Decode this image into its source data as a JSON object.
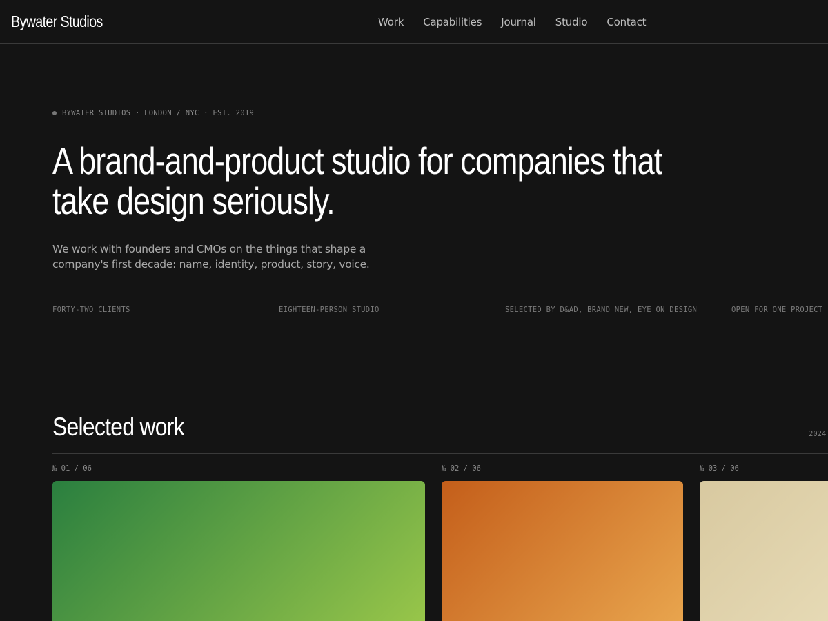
{
  "header": {
    "brand": "Bywater Studios",
    "nav": [
      "Work",
      "Capabilities",
      "Journal",
      "Studio",
      "Contact"
    ]
  },
  "hero": {
    "eyebrow": "BYWATER STUDIOS · LONDON / NYC · EST. 2019",
    "headline": "A brand-and-product studio for companies that take design seriously.",
    "lede": "We work with founders and CMOs on the things that shape a company's first decade: name, identity, product, story, voice.",
    "stats": [
      "FORTY-TWO CLIENTS",
      "EIGHTEEN-PERSON STUDIO",
      "SELECTED BY D&AD, BRAND NEW, EYE ON DESIGN",
      "OPEN FOR ONE PROJECT ·"
    ]
  },
  "work": {
    "title": "Selected work",
    "year": "2024",
    "items": [
      {
        "number": "№ 01 / 06",
        "gradient_from": "#2a7f3f",
        "gradient_to": "#9cc84a"
      },
      {
        "number": "№ 02 / 06",
        "gradient_from": "#c45e1a",
        "gradient_to": "#eaa850"
      },
      {
        "number": "№ 03 / 06",
        "gradient_from": "#d8c9a0",
        "gradient_to": "#e8dcb8"
      }
    ]
  }
}
